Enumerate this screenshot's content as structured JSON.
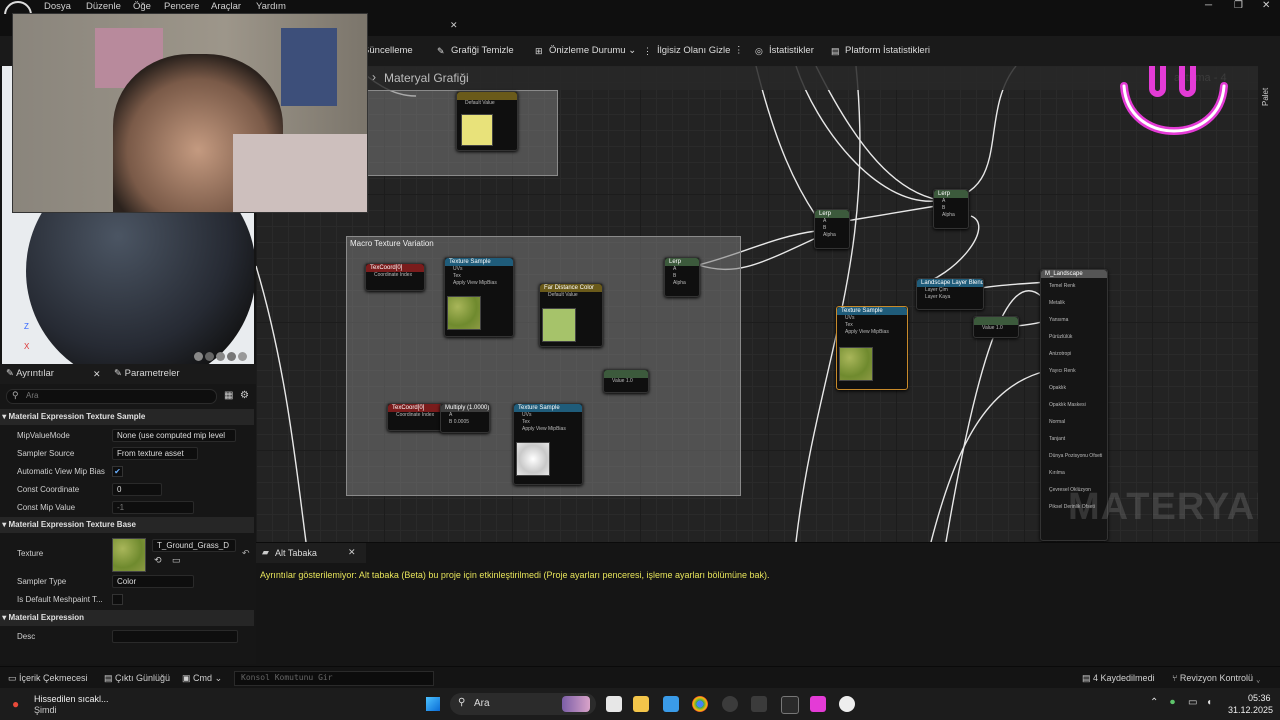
{
  "menubar": {
    "items": [
      "Dosya",
      "Düzenle",
      "Öğe",
      "Pencere",
      "Araçlar",
      "Yardım"
    ]
  },
  "toolbar": {
    "buttons": [
      "Güncelleme",
      "Grafiği Temizle",
      "Önizleme Durumu",
      "İlgisiz Olanı Gizle",
      "İstatistikler",
      "Platform İstatistikleri"
    ]
  },
  "graph": {
    "title": "Materyal Grafiği",
    "palette_label": "Palet",
    "faded_tab_text": "aştırma - 4",
    "watermark": "MATERYAL",
    "comment_box_label": "Macro Texture Variation",
    "nodes": {
      "texcoord_label": "TexCoord[0]",
      "coordinate_index": "Coordinate Index",
      "texture_sample": "Texture Sample",
      "uvs": "UVs",
      "tex": "Tex",
      "apply_view_mip_bias": "Apply View MipBias",
      "rgb": "RGB",
      "r": "R",
      "g": "G",
      "b": "B",
      "a": "A",
      "rgba": "RGBA",
      "lerp": "Lerp",
      "alpha": "Alpha",
      "param_color_label": "Far Distance Color",
      "default_value": "Default Value",
      "value": "Value",
      "multiply_label": "Multiply (1.0000)",
      "landscape_layer_blend": "Landscape Layer Blend",
      "layer_grass": "Layer Çim",
      "layer_rock": "Layer Kaya",
      "scalar_value": "1.0",
      "const_value": "0.0005",
      "result_pins": [
        "Temel Renk",
        "Metalik",
        "Yansıma",
        "Pürüzlülük",
        "Anizotropi",
        "Yayıcı Renk",
        "Opaklık",
        "Opaklık Maskesi",
        "Normal",
        "Tanjant",
        "Dünya Pozisyonu Ofseti",
        "Kırılma",
        "Çevresel Oklüzyon",
        "Piksel Derinlik Ofseti"
      ],
      "result_title": "M_Landscape",
      "tangent_values": [
        "1.0",
        "0.0",
        "0.0"
      ],
      "wpo_values": [
        "0.0",
        "0.0",
        "0.0"
      ],
      "ao_value": "1.0",
      "pdo_value": "0.0",
      "emissive_value": "0.0",
      "anisotropy_value": "0.0",
      "metallic_value": "0.0",
      "specular_value": "0.5"
    }
  },
  "preview": {
    "axis_z": "Z",
    "axis_x": "X"
  },
  "details": {
    "tab_details": "Ayrıntılar",
    "tab_parameters": "Parametreler",
    "search_placeholder": "Ara",
    "section1": "Material Expression Texture Sample",
    "mip_value_mode_label": "MipValueMode",
    "mip_value_mode_value": "None (use computed mip level",
    "sampler_source_label": "Sampler Source",
    "sampler_source_value": "From texture asset",
    "auto_view_mip_bias_label": "Automatic View Mip Bias",
    "const_coordinate_label": "Const Coordinate",
    "const_coordinate_value": "0",
    "const_mip_value_label": "Const Mip Value",
    "const_mip_value_value": "-1",
    "section2": "Material Expression Texture Base",
    "texture_label": "Texture",
    "texture_value": "T_Ground_Grass_D",
    "sampler_type_label": "Sampler Type",
    "sampler_type_value": "Color",
    "is_default_meshpaint_label": "Is Default Meshpaint T...",
    "section3": "Material Expression",
    "desc_label": "Desc"
  },
  "alt_panel": {
    "tab_label": "Alt Tabaka",
    "message": "Ayrıntılar gösterilemiyor: Alt tabaka (Beta) bu proje için etkinleştirilmedi (Proje ayarları penceresi, işleme ayarları bölümüne bak)."
  },
  "statusbar": {
    "content_drawer": "İçerik Çekmecesi",
    "output_log": "Çıktı Günlüğü",
    "cmd": "Cmd",
    "console_placeholder": "Konsol Komutunu Gir",
    "saved": "4 Kaydedilmedi",
    "revision_control": "Revizyon Kontrolü"
  },
  "taskbar": {
    "weather_line1": "Hissedilen sıcakl...",
    "weather_line2": "Şimdi",
    "search_label": "Ara",
    "time": "05:36",
    "date": "31.12.2025"
  },
  "colors": {
    "accent_yellow": "#e6e35a",
    "smiley_pink": "#e43bd6",
    "texture_node_header": "#1f5c7a",
    "texcoord_node_header": "#7a1c1c",
    "lerp_node_header": "#3c5a3c",
    "param_node_header": "#6a5a1a"
  }
}
